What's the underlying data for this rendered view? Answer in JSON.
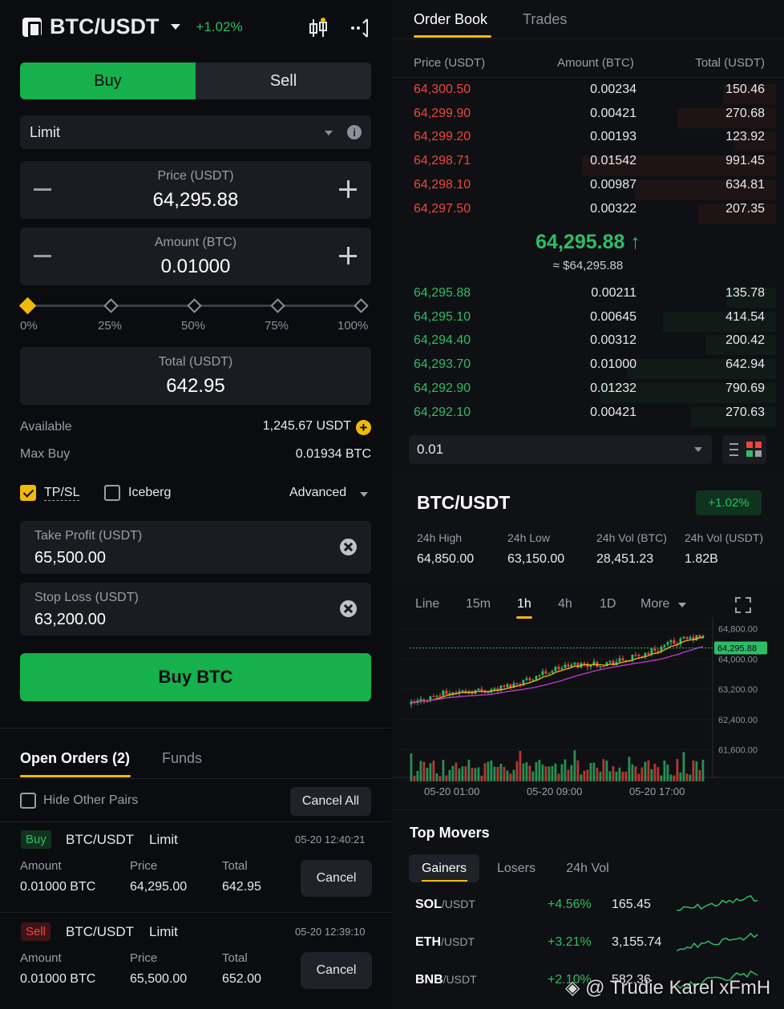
{
  "order_form": {
    "pair": "BTC/USDT",
    "change": "+1.02%",
    "side_tabs": [
      "Buy",
      "Sell"
    ],
    "order_type": "Limit",
    "price_label": "Price (USDT)",
    "price_value": "64,295.88",
    "amount_label": "Amount (BTC)",
    "amount_value": "0.01000",
    "slider_marks": [
      "0%",
      "25%",
      "50%",
      "75%",
      "100%"
    ],
    "slider_percent": 0,
    "total_label": "Total (USDT)",
    "total_value": "642.95",
    "available_label": "Available",
    "available_value": "1,245.67 USDT",
    "maxbuy_label": "Max Buy",
    "maxbuy_value": "0.01934 BTC",
    "tpsl_label": "TP/SL",
    "tpsl_checked": true,
    "iceberg_label": "Iceberg",
    "iceberg_checked": false,
    "advanced_label": "Advanced",
    "tp_label": "Take Profit (USDT)",
    "tp_value": "65,500.00",
    "sl_label": "Stop Loss (USDT)",
    "sl_value": "63,200.00",
    "submit_label": "Buy BTC"
  },
  "orders": {
    "tabs": [
      "Open Orders (2)",
      "Funds"
    ],
    "hide_pairs_label": "Hide Other Pairs",
    "cancel_all_label": "Cancel All",
    "headers": [
      "Amount",
      "Price",
      "Total"
    ],
    "cancel_label": "Cancel",
    "items": [
      {
        "side": "Buy",
        "pair": "BTC/USDT",
        "type": "Limit",
        "time": "05-20 12:40:21",
        "amount": "0.01000 BTC",
        "price": "64,295.00",
        "total": "642.95"
      },
      {
        "side": "Sell",
        "pair": "BTC/USDT",
        "type": "Limit",
        "time": "05-20 12:39:10",
        "amount": "0.01000 BTC",
        "price": "65,500.00",
        "total": "652.00"
      }
    ]
  },
  "orderbook": {
    "tabs": [
      "Order Book",
      "Trades"
    ],
    "headers": [
      "Price (USDT)",
      "Amount (BTC)",
      "Total (USDT)"
    ],
    "asks": [
      {
        "price": "64,300.50",
        "amount": "0.00234",
        "total": "150.46",
        "depth": 0.15
      },
      {
        "price": "64,299.90",
        "amount": "0.00421",
        "total": "270.68",
        "depth": 0.28
      },
      {
        "price": "64,299.20",
        "amount": "0.00193",
        "total": "123.92",
        "depth": 0.12
      },
      {
        "price": "64,298.71",
        "amount": "0.01542",
        "total": "991.45",
        "depth": 0.55
      },
      {
        "price": "64,298.10",
        "amount": "0.00987",
        "total": "634.81",
        "depth": 0.4
      },
      {
        "price": "64,297.50",
        "amount": "0.00322",
        "total": "207.35",
        "depth": 0.22
      }
    ],
    "last_price": "64,295.88",
    "last_price_fiat": "≈ $64,295.88",
    "bids": [
      {
        "price": "64,295.88",
        "amount": "0.00211",
        "total": "135.78",
        "depth": 0.14
      },
      {
        "price": "64,295.10",
        "amount": "0.00645",
        "total": "414.54",
        "depth": 0.32
      },
      {
        "price": "64,294.40",
        "amount": "0.00312",
        "total": "200.42",
        "depth": 0.2
      },
      {
        "price": "64,293.70",
        "amount": "0.01000",
        "total": "642.94",
        "depth": 0.42
      },
      {
        "price": "64,292.90",
        "amount": "0.01232",
        "total": "790.69",
        "depth": 0.5
      },
      {
        "price": "64,292.10",
        "amount": "0.00421",
        "total": "270.63",
        "depth": 0.24
      }
    ],
    "precision": "0.01"
  },
  "ticker": {
    "pair": "BTC/USDT",
    "change": "+1.02%",
    "stats": [
      {
        "label": "24h High",
        "value": "64,850.00"
      },
      {
        "label": "24h Low",
        "value": "63,150.00"
      },
      {
        "label": "24h Vol (BTC)",
        "value": "28,451.23"
      },
      {
        "label": "24h Vol (USDT)",
        "value": "1.82B"
      }
    ]
  },
  "chart_data": {
    "type": "candlestick",
    "timeframes": [
      "Line",
      "15m",
      "1h",
      "4h",
      "1D",
      "More"
    ],
    "active_timeframe": "1h",
    "price_ticks": [
      "64,800.00",
      "64,000.00",
      "63,200.00",
      "62,400.00",
      "61,600.00"
    ],
    "current_price_tag": "64,295.88",
    "x_ticks": [
      "05-20 01:00",
      "05-20 09:00",
      "05-20 17:00"
    ],
    "ylim": [
      61400,
      64900
    ]
  },
  "movers": {
    "title": "Top Movers",
    "tabs": [
      "Gainers",
      "Losers",
      "24h Vol"
    ],
    "items": [
      {
        "base": "SOL",
        "quote": "/USDT",
        "change": "+4.56%",
        "price": "165.45"
      },
      {
        "base": "ETH",
        "quote": "/USDT",
        "change": "+3.21%",
        "price": "3,155.74"
      },
      {
        "base": "BNB",
        "quote": "/USDT",
        "change": "+2.10%",
        "price": "582.36"
      }
    ]
  },
  "watermark": "@ Trudie Karel xFmH",
  "colors": {
    "up": "#2ebd67",
    "down": "#f0443d",
    "accent": "#f0b90b",
    "buy": "#16b04d"
  }
}
